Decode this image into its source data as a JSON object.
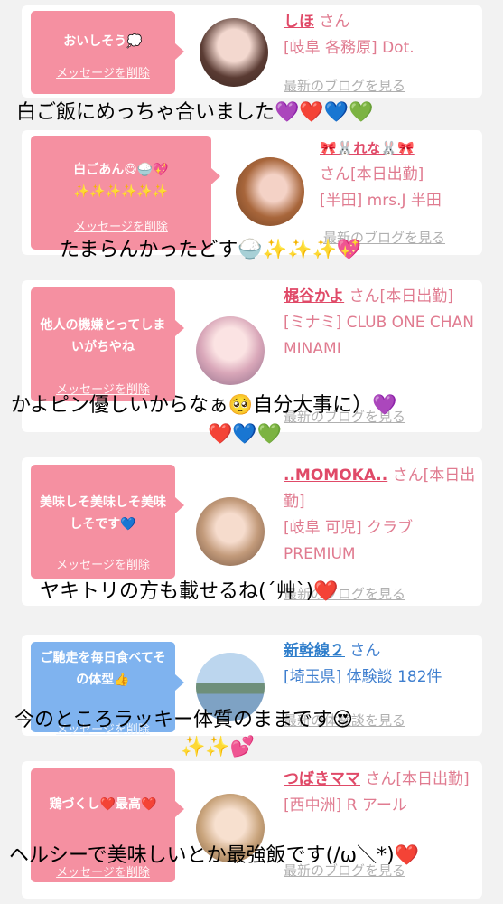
{
  "cards": [
    {
      "bubble_message": "おいしそう💭",
      "bubble_delete": "メッセージを削除",
      "user_name": "しほ",
      "suffix": "さん",
      "area": "[岐阜 各務原] Dot.",
      "blog_link": "最新のブログを見る",
      "caption": "白ご飯にめっちゃ合いました💜❤️💙💚"
    },
    {
      "bubble_message": "白ごあん😋🍚💖 ✨✨✨✨✨✨",
      "bubble_delete": "メッセージを削除",
      "user_name": "🎀🐰れな🐰🎀",
      "suffix": "さん[本日出勤]",
      "area": "[半田] mrs.J 半田",
      "blog_link": "最新のブログを見る",
      "caption": "たまらんかったどす🍚✨✨✨💖"
    },
    {
      "bubble_message": "他人の機嫌とってしまいがちやね",
      "bubble_delete": "メッセージを削除",
      "user_name": "梶谷かよ",
      "suffix": "さん[本日出勤]",
      "area": "[ミナミ] CLUB ONE CHAN MINAMI",
      "blog_link": "最新のブログを見る",
      "caption_line1": "かよピン優しいからなぁ🥺自分大事に）💜",
      "caption_line2": "❤️💙💚"
    },
    {
      "bubble_message": "美味しそ美味しそ美味しそです💙",
      "bubble_delete": "メッセージを削除",
      "user_name": "..MOMOKA..",
      "suffix": "さん[本日出勤]",
      "area": "[岐阜 可児] クラブ PREMIUM",
      "blog_link": "最新のブログを見る",
      "caption": "ヤキトリの方も載せるね(´艸`)❤️"
    },
    {
      "bubble_message": "ご馳走を毎日食べてその体型👍",
      "bubble_delete": "メッセージを削除",
      "user_name": "新幹線２",
      "suffix": "さん",
      "area": "[埼玉県] 体験談 182件",
      "blog_link": "最新の体験談を見る",
      "caption_line1": "今のところラッキー体質のままです😍",
      "caption_line2": "✨✨💕"
    },
    {
      "bubble_message": "鶏づくし❤️最高❤️",
      "bubble_delete": "メッセージを削除",
      "user_name": "つばきママ",
      "suffix": "さん[本日出勤]",
      "area": "[西中洲] R アール",
      "blog_link": "最新のブログを見る",
      "caption": "ヘルシーで美味しいとか最強飯です(/ω＼*)❤️"
    }
  ],
  "colors": {
    "bubble_pink": "#f590a1",
    "bubble_blue": "#7fb3ef",
    "name_pink": "#e04a68",
    "name_blue": "#2f7ecb"
  }
}
